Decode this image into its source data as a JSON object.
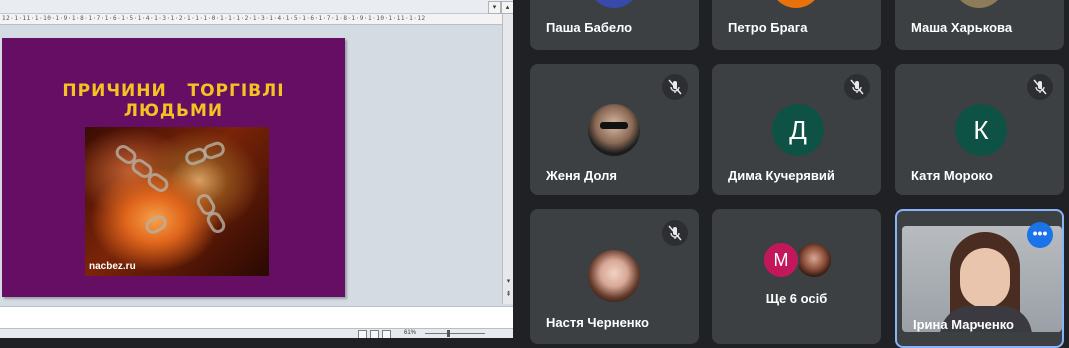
{
  "editor": {
    "ruler_text": "12·1·11·1·10·1·9·1·8·1·7·1·6·1·5·1·4·1·3·1·2·1·1·1·0·1·1·1·2·1·3·1·4·1·5·1·6·1·7·1·8·1·9·1·10·1·11·1·12",
    "slide": {
      "title_line1": "ПРИЧИНИ   ТОРГІВЛІ",
      "title_line2": "ЛЮДЬМИ",
      "photo_caption": "nacbez.ru",
      "background": "#660e64",
      "title_color": "#f4c320"
    },
    "status": {
      "zoom": "61%"
    }
  },
  "meeting": {
    "tiles": [
      {
        "name": "Паша Бабело",
        "muted": false
      },
      {
        "name": "Петро Брага",
        "muted": false
      },
      {
        "name": "Маша Харькова",
        "muted": false
      },
      {
        "name": "Женя Доля",
        "muted": true,
        "avatar": "photo"
      },
      {
        "name": "Дима Кучерявий",
        "muted": true,
        "initial": "Д",
        "color": "#0d5245"
      },
      {
        "name": "Катя Мороко",
        "muted": true,
        "initial": "К",
        "color": "#0d5245"
      },
      {
        "name": "Настя Черненко",
        "muted": true,
        "avatar": "photo"
      },
      {
        "name": "Ще 6 осіб",
        "initial": "М",
        "color": "#c2185b"
      },
      {
        "name": "Ірина Марченко",
        "active": true,
        "border": "#8ab4f8"
      }
    ]
  }
}
